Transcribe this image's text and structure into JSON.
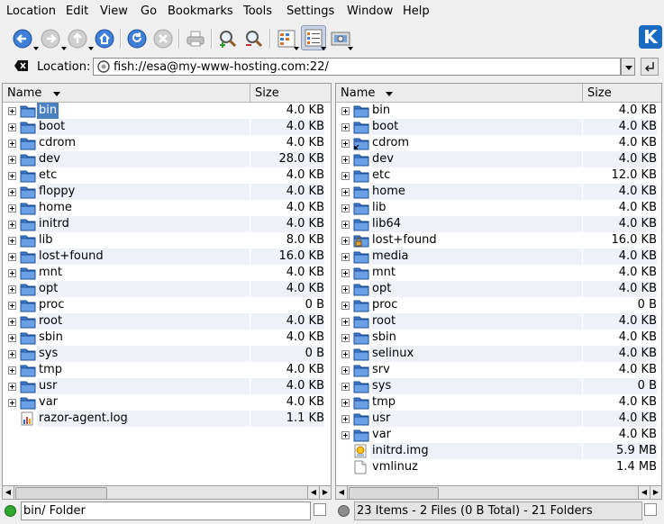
{
  "menu": [
    "Location",
    "Edit",
    "View",
    "Go",
    "Bookmarks",
    "Tools",
    "Settings",
    "Window",
    "Help"
  ],
  "toolbar": {
    "icons": [
      "back-icon",
      "forward-icon",
      "up-icon",
      "home-icon",
      "reload-icon",
      "stop-icon",
      "print-icon",
      "zoom-in-icon",
      "zoom-out-icon",
      "icon-view-icon",
      "detailed-view-icon",
      "image-preview-icon"
    ]
  },
  "location": {
    "label": "Location:",
    "value": "fish://esa@my-www-hosting.com:22/"
  },
  "columns": {
    "name": "Name",
    "size": "Size"
  },
  "left_panel": {
    "rows": [
      {
        "name": "bin",
        "size": "4.0 KB",
        "type": "folder",
        "selected": true
      },
      {
        "name": "boot",
        "size": "4.0 KB",
        "type": "folder"
      },
      {
        "name": "cdrom",
        "size": "4.0 KB",
        "type": "folder"
      },
      {
        "name": "dev",
        "size": "28.0 KB",
        "type": "folder"
      },
      {
        "name": "etc",
        "size": "4.0 KB",
        "type": "folder"
      },
      {
        "name": "floppy",
        "size": "4.0 KB",
        "type": "folder"
      },
      {
        "name": "home",
        "size": "4.0 KB",
        "type": "folder"
      },
      {
        "name": "initrd",
        "size": "4.0 KB",
        "type": "folder"
      },
      {
        "name": "lib",
        "size": "8.0 KB",
        "type": "folder"
      },
      {
        "name": "lost+found",
        "size": "16.0 KB",
        "type": "folder"
      },
      {
        "name": "mnt",
        "size": "4.0 KB",
        "type": "folder"
      },
      {
        "name": "opt",
        "size": "4.0 KB",
        "type": "folder"
      },
      {
        "name": "proc",
        "size": "0 B",
        "type": "folder"
      },
      {
        "name": "root",
        "size": "4.0 KB",
        "type": "folder"
      },
      {
        "name": "sbin",
        "size": "4.0 KB",
        "type": "folder"
      },
      {
        "name": "sys",
        "size": "0 B",
        "type": "folder"
      },
      {
        "name": "tmp",
        "size": "4.0 KB",
        "type": "folder"
      },
      {
        "name": "usr",
        "size": "4.0 KB",
        "type": "folder"
      },
      {
        "name": "var",
        "size": "4.0 KB",
        "type": "folder"
      },
      {
        "name": "razor-agent.log",
        "size": "1.1 KB",
        "type": "log"
      }
    ],
    "status": "bin/  Folder",
    "led_color": "#2fa82f"
  },
  "right_panel": {
    "rows": [
      {
        "name": "bin",
        "size": "4.0 KB",
        "type": "folder"
      },
      {
        "name": "boot",
        "size": "4.0 KB",
        "type": "folder"
      },
      {
        "name": "cdrom",
        "size": "4.0 KB",
        "type": "folder-link"
      },
      {
        "name": "dev",
        "size": "4.0 KB",
        "type": "folder"
      },
      {
        "name": "etc",
        "size": "12.0 KB",
        "type": "folder"
      },
      {
        "name": "home",
        "size": "4.0 KB",
        "type": "folder"
      },
      {
        "name": "lib",
        "size": "4.0 KB",
        "type": "folder"
      },
      {
        "name": "lib64",
        "size": "4.0 KB",
        "type": "folder"
      },
      {
        "name": "lost+found",
        "size": "16.0 KB",
        "type": "folder-locked"
      },
      {
        "name": "media",
        "size": "4.0 KB",
        "type": "folder"
      },
      {
        "name": "mnt",
        "size": "4.0 KB",
        "type": "folder"
      },
      {
        "name": "opt",
        "size": "4.0 KB",
        "type": "folder"
      },
      {
        "name": "proc",
        "size": "0 B",
        "type": "folder"
      },
      {
        "name": "root",
        "size": "4.0 KB",
        "type": "folder"
      },
      {
        "name": "sbin",
        "size": "4.0 KB",
        "type": "folder"
      },
      {
        "name": "selinux",
        "size": "4.0 KB",
        "type": "folder"
      },
      {
        "name": "srv",
        "size": "4.0 KB",
        "type": "folder"
      },
      {
        "name": "sys",
        "size": "0 B",
        "type": "folder"
      },
      {
        "name": "tmp",
        "size": "4.0 KB",
        "type": "folder"
      },
      {
        "name": "usr",
        "size": "4.0 KB",
        "type": "folder"
      },
      {
        "name": "var",
        "size": "4.0 KB",
        "type": "folder"
      },
      {
        "name": "initrd.img",
        "size": "5.9 MB",
        "type": "image-file"
      },
      {
        "name": "vmlinuz",
        "size": "1.4 MB",
        "type": "file"
      }
    ],
    "status": "23 Items - 2 Files (0 B Total) - 21 Folders",
    "led_color": "#8c8c8c"
  },
  "colors": {
    "folder": "#3d7bd0",
    "selection": "#4a7fc0",
    "alt_row": "#eef2f8"
  }
}
